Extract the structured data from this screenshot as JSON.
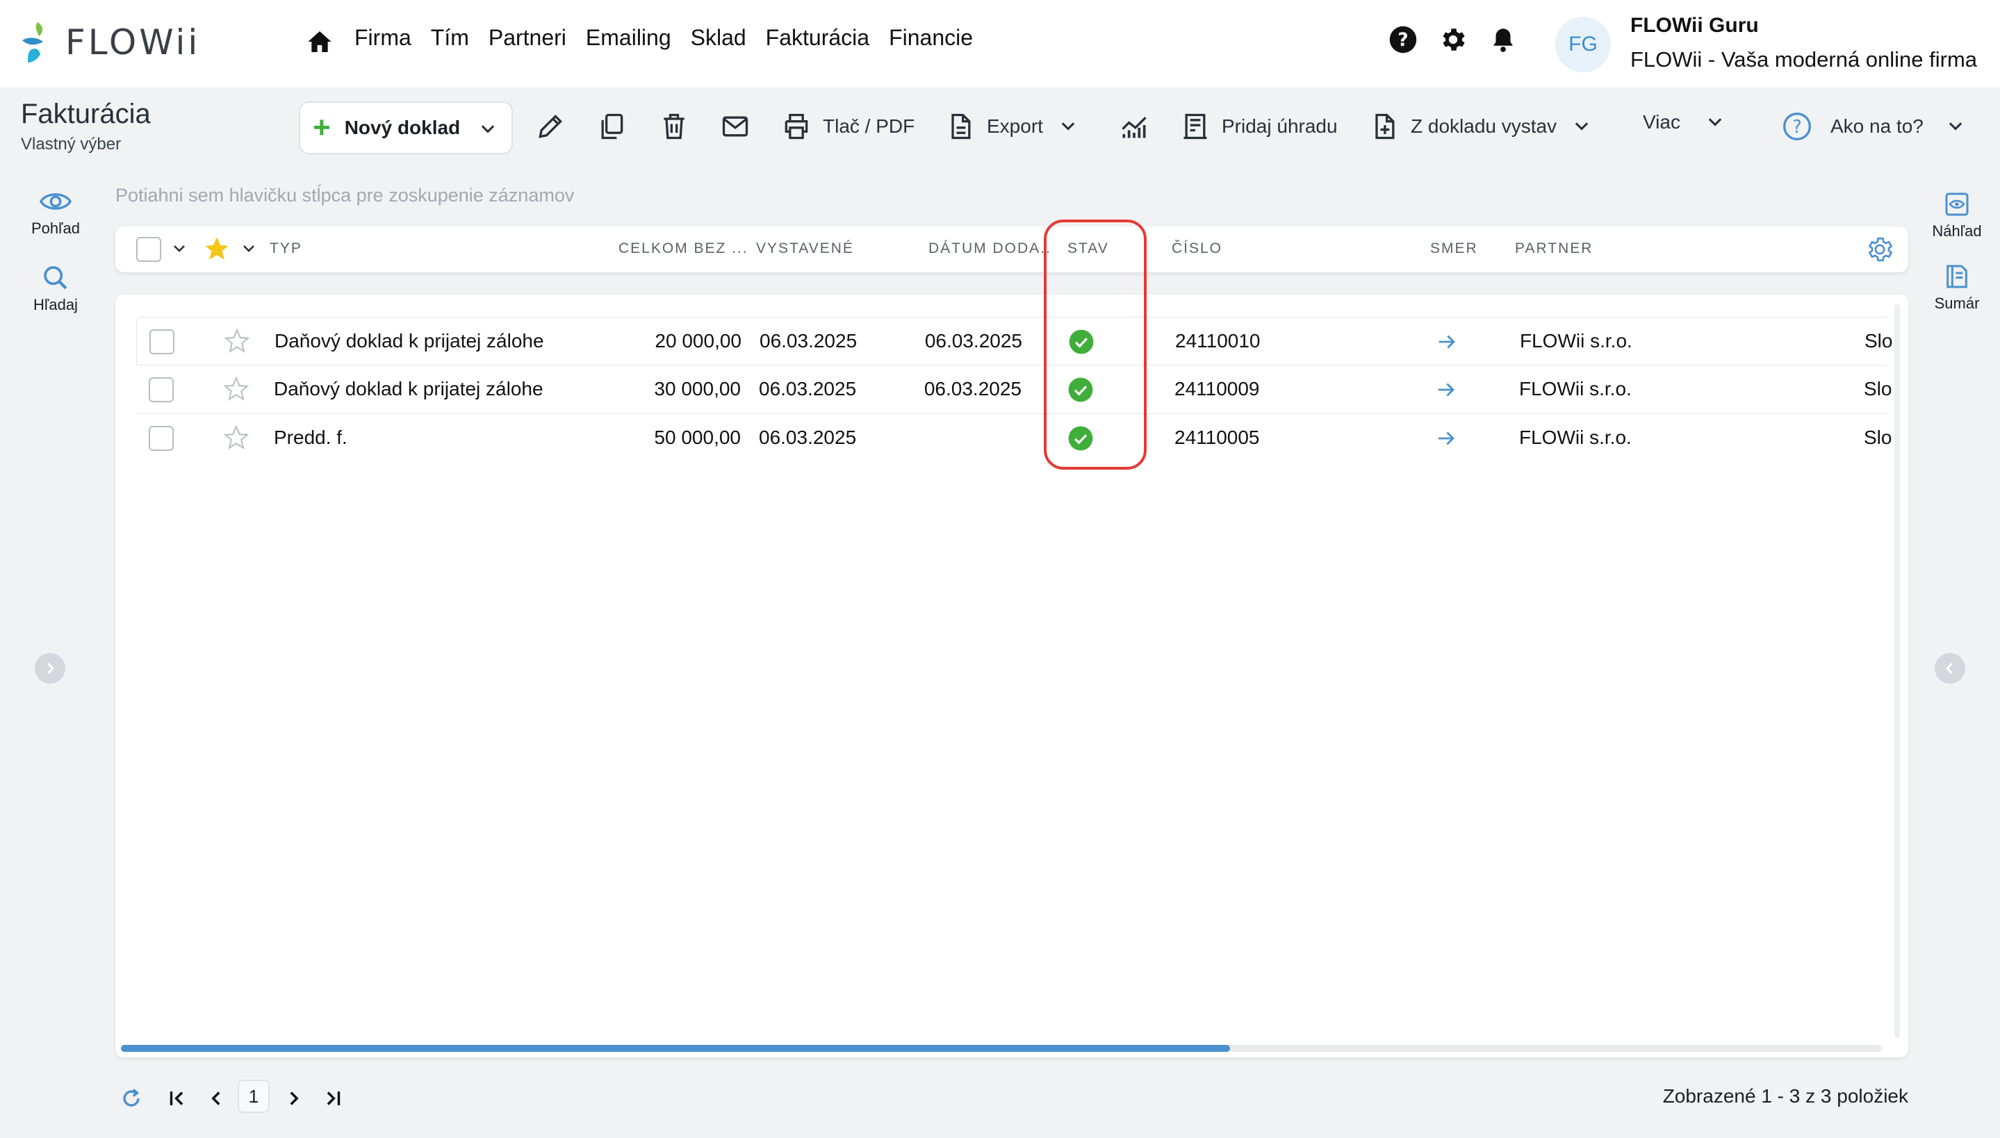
{
  "app": {
    "logo_text": "FLOWii",
    "nav": [
      "Firma",
      "Tím",
      "Partneri",
      "Emailing",
      "Sklad",
      "Fakturácia",
      "Financie"
    ],
    "user": {
      "initials": "FG",
      "name": "FLOWii Guru",
      "company": "FLOWii - Vaša moderná online firma"
    }
  },
  "page": {
    "title": "Fakturácia",
    "subtitle": "Vlastný výber"
  },
  "toolbar": {
    "new_doc": "Nový doklad",
    "print": "Tlač / PDF",
    "export": "Export",
    "add_payment": "Pridaj úhradu",
    "from_doc": "Z dokladu vystav",
    "more": "Viac",
    "help": "Ako na to?"
  },
  "left_rail": {
    "view": "Pohľad",
    "search": "Hľadaj"
  },
  "right_rail": {
    "preview": "Náhľad",
    "summary": "Sumár"
  },
  "grid": {
    "group_hint": "Potiahni sem hlavičku stĺpca pre zoskupenie záznamov",
    "columns": {
      "typ": "TYP",
      "celkom": "CELKOM BEZ ...",
      "vystavene": "VYSTAVENÉ",
      "datum": "DÁTUM DODA..",
      "stav": "STAV",
      "cislo": "ČÍSLO",
      "smer": "SMER",
      "partner": "PARTNER"
    },
    "rows": [
      {
        "typ": "Daňový doklad k prijatej zálohe",
        "celkom": "20 000,00",
        "vystavene": "06.03.2025",
        "datum": "06.03.2025",
        "stav": "ok",
        "cislo": "24110010",
        "partner": "FLOWii s.r.o.",
        "extra": "Slo"
      },
      {
        "typ": "Daňový doklad k prijatej zálohe",
        "celkom": "30 000,00",
        "vystavene": "06.03.2025",
        "datum": "06.03.2025",
        "stav": "ok",
        "cislo": "24110009",
        "partner": "FLOWii s.r.o.",
        "extra": "Slo"
      },
      {
        "typ": "Predd. f.",
        "celkom": "50 000,00",
        "vystavene": "06.03.2025",
        "datum": "",
        "stav": "ok",
        "cislo": "24110005",
        "partner": "FLOWii s.r.o.",
        "extra": "Slo"
      }
    ],
    "scroll_fraction": 0.63
  },
  "pager": {
    "page": "1",
    "info": "Zobrazené 1 - 3 z 3 položiek"
  },
  "colors": {
    "accent": "#4a90d0",
    "ok": "#3fae3a",
    "highlight": "#e53935"
  }
}
